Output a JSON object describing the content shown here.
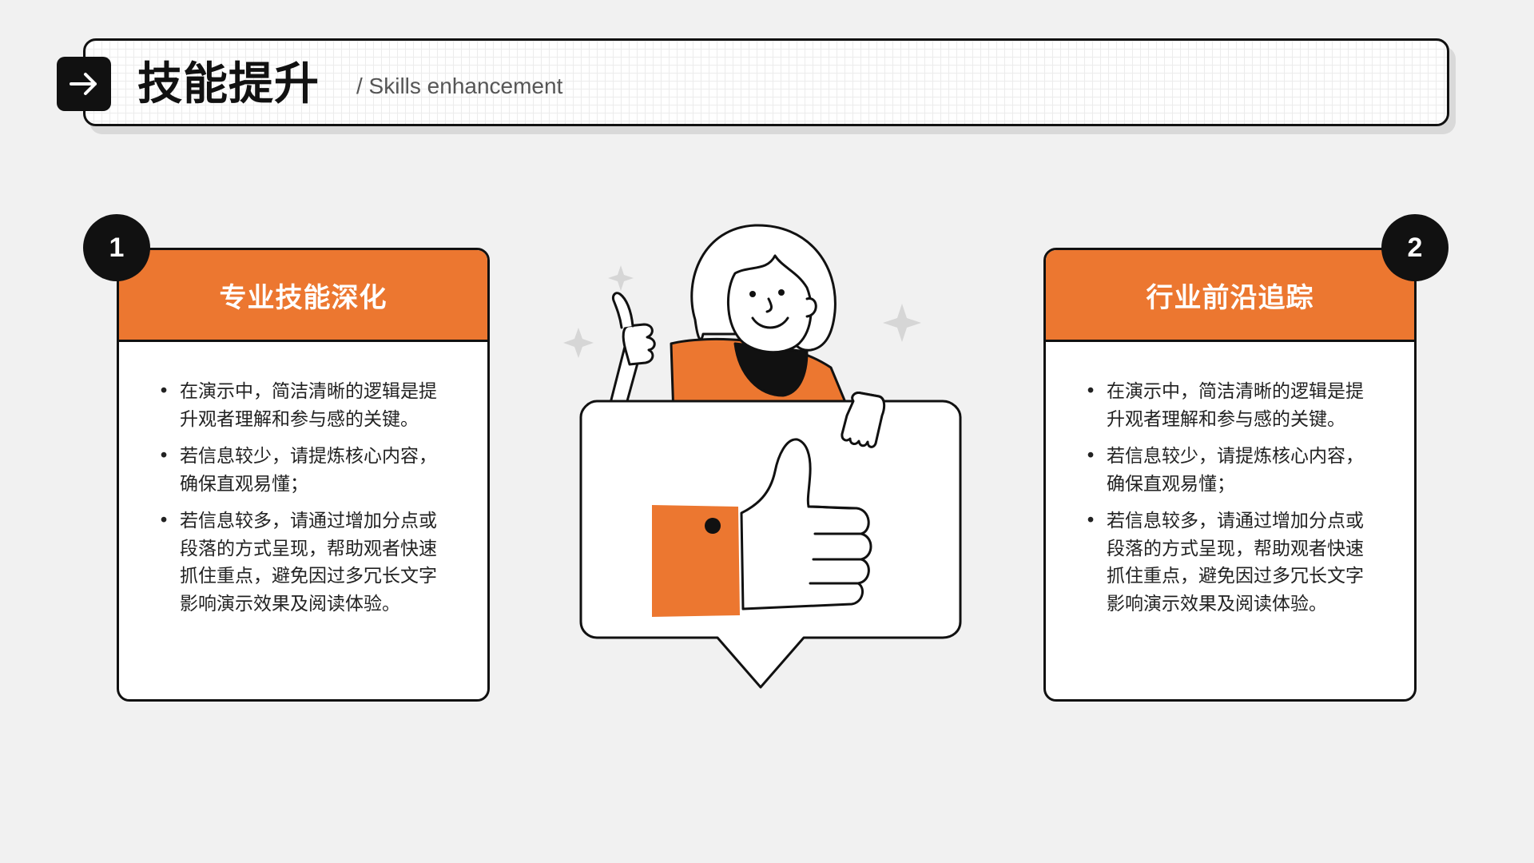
{
  "header": {
    "title": "技能提升",
    "subtitle": "/ Skills enhancement",
    "icon": "arrow-right-icon"
  },
  "cards": [
    {
      "number": "1",
      "title": "专业技能深化",
      "items": [
        "在演示中，简洁清晰的逻辑是提升观者理解和参与感的关键。",
        "若信息较少，请提炼核心内容，确保直观易懂；",
        "若信息较多，请通过增加分点或段落的方式呈现，帮助观者快速抓住重点，避免因过多冗长文字影响演示效果及阅读体验。"
      ]
    },
    {
      "number": "2",
      "title": "行业前沿追踪",
      "items": [
        "在演示中，简洁清晰的逻辑是提升观者理解和参与感的关键。",
        "若信息较少，请提炼核心内容，确保直观易懂；",
        "若信息较多，请通过增加分点或段落的方式呈现，帮助观者快速抓住重点，避免因过多冗长文字影响演示效果及阅读体验。"
      ]
    }
  ],
  "bullet": "•",
  "colors": {
    "accent": "#ec7730",
    "dark": "#111111",
    "background": "#f1f1f1"
  },
  "illustration": {
    "icons": [
      "woman-thumbs-up-icon",
      "thumbs-up-speech-bubble-icon",
      "sparkle-icon"
    ]
  }
}
